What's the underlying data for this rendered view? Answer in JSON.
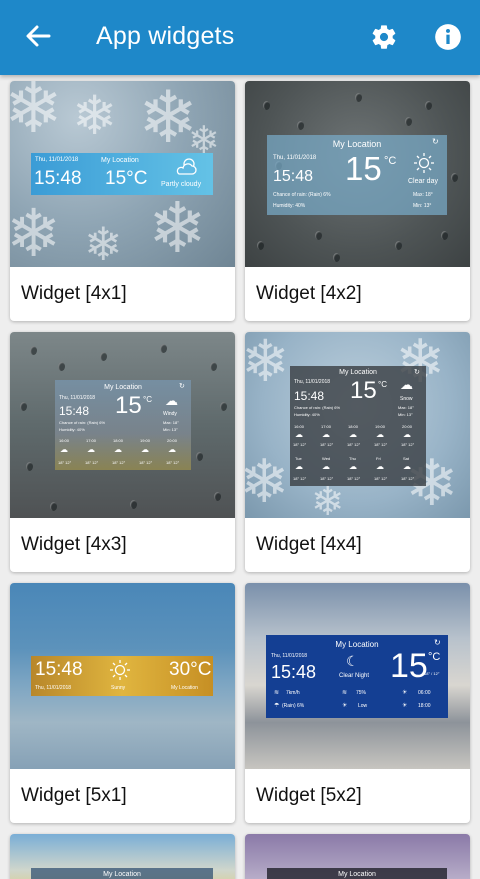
{
  "header": {
    "title": "App widgets",
    "back_icon": "arrow-left-icon",
    "settings_icon": "gear-icon",
    "info_icon": "info-icon",
    "color": "#1e88c9"
  },
  "cards": [
    {
      "label": "Widget [4x1]"
    },
    {
      "label": "Widget [4x2]"
    },
    {
      "label": "Widget [4x3]"
    },
    {
      "label": "Widget [4x4]"
    },
    {
      "label": "Widget [5x1]"
    },
    {
      "label": "Widget [5x2]"
    }
  ],
  "w41": {
    "date": "Thu, 11/01/2018",
    "location": "My Location",
    "time": "15:48",
    "temp": "15°C",
    "condition": "Partly cloudy"
  },
  "w42": {
    "location": "My Location",
    "date": "Thu, 11/01/2018",
    "time": "15:48",
    "temp": "15",
    "unit": "°C",
    "condition": "Clear day",
    "rain": "Chance of rain: (Rain) 6%",
    "humidity": "Humidity: 40%",
    "max": "Max: 18°",
    "min": "Min: 13°"
  },
  "w43": {
    "location": "My Location",
    "date": "Thu, 11/01/2018",
    "time": "15:48",
    "temp": "15",
    "unit": "°C",
    "condition": "Windy",
    "rain": "Chance of rain: (Rain) 6%",
    "humidity": "Humidity: 40%",
    "max": "Max: 18°",
    "min": "Min: 13°",
    "hours": [
      "16:00",
      "17:00",
      "18:00",
      "19:00",
      "20:00"
    ],
    "ranges": [
      "18° 12°",
      "18° 12°",
      "18° 12°",
      "18° 12°",
      "18° 12°"
    ]
  },
  "w44": {
    "location": "My Location",
    "date": "Thu, 11/01/2018",
    "time": "15:48",
    "temp": "15",
    "unit": "°C",
    "condition": "Snow",
    "rain": "Chance of rain: (Rain) 6%",
    "humidity": "Humidity: 40%",
    "max": "Max: 18°",
    "min": "Min: 13°",
    "hours": [
      "16:00",
      "17:00",
      "18:00",
      "19:00",
      "20:00"
    ],
    "days": [
      "Tue",
      "Wed",
      "Thu",
      "Fri",
      "Sat"
    ],
    "ranges": [
      "18° 12°",
      "18° 12°",
      "18° 12°",
      "18° 12°",
      "18° 12°"
    ]
  },
  "w51": {
    "time": "15:48",
    "date": "Thu, 11/01/2018",
    "condition": "Sunny",
    "temp": "30°C",
    "location": "My Location"
  },
  "w52": {
    "location": "My Location",
    "date": "Thu, 11/01/2018",
    "time": "15:48",
    "condition": "Clear Night",
    "temp": "15",
    "unit": "°C",
    "range": "18° / 12°",
    "wind": "7km/h",
    "humidity": "75%",
    "rain": "(Rain) 6%",
    "uv": "Low",
    "sunrise": "06:00",
    "sunset": "18:00"
  },
  "peek": {
    "left_location": "My Location",
    "right_location": "My Location"
  }
}
